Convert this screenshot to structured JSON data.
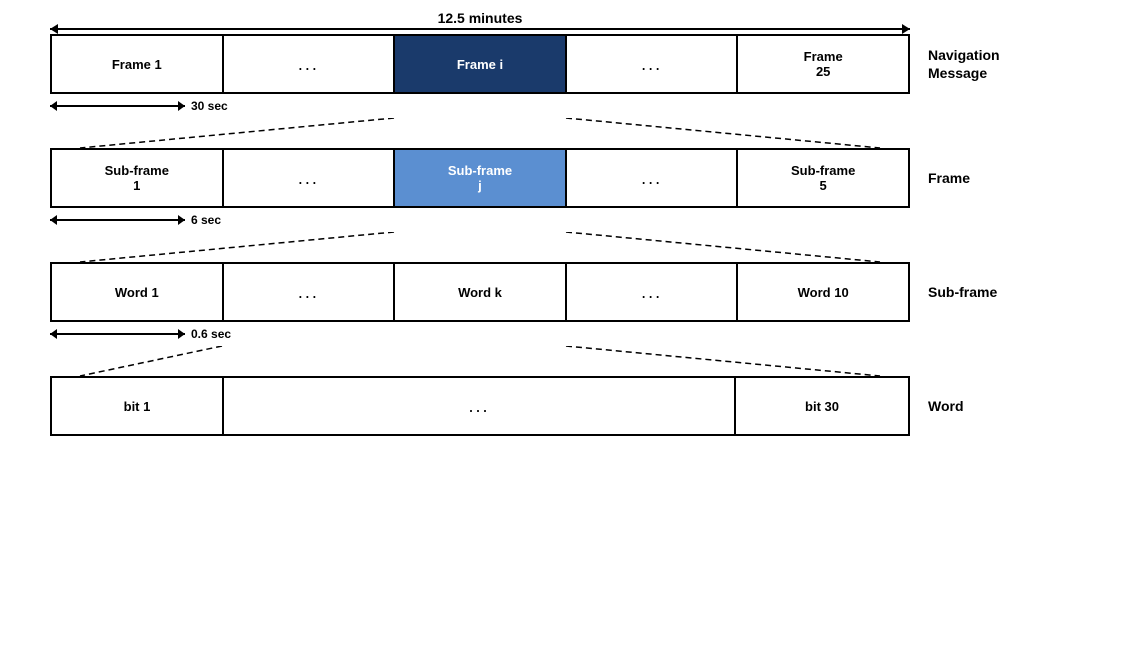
{
  "top_arrow": {
    "label": "12.5 minutes"
  },
  "rows": [
    {
      "id": "nav-message",
      "cells": [
        {
          "label": "Frame 1",
          "type": "normal"
        },
        {
          "label": "...",
          "type": "dots"
        },
        {
          "label": "Frame i",
          "type": "highlight-dark"
        },
        {
          "label": "...",
          "type": "dots"
        },
        {
          "label": "Frame\n25",
          "type": "normal"
        }
      ],
      "side_label": "Navigation\nMessage",
      "duration": "30 sec"
    },
    {
      "id": "frame",
      "cells": [
        {
          "label": "Sub-frame\n1",
          "type": "normal"
        },
        {
          "label": "...",
          "type": "dots"
        },
        {
          "label": "Sub-frame\nj",
          "type": "highlight-light"
        },
        {
          "label": "...",
          "type": "dots"
        },
        {
          "label": "Sub-frame\n5",
          "type": "normal"
        }
      ],
      "side_label": "Frame",
      "duration": "6 sec"
    },
    {
      "id": "subframe",
      "cells": [
        {
          "label": "Word 1",
          "type": "normal"
        },
        {
          "label": "...",
          "type": "dots"
        },
        {
          "label": "Word k",
          "type": "normal"
        },
        {
          "label": "...",
          "type": "dots"
        },
        {
          "label": "Word 10",
          "type": "normal"
        }
      ],
      "side_label": "Sub-frame",
      "duration": "0.6 sec"
    },
    {
      "id": "word",
      "cells": [
        {
          "label": "bit 1",
          "type": "normal"
        },
        {
          "label": "...",
          "type": "dots"
        },
        {
          "label": "bit 30",
          "type": "normal"
        }
      ],
      "side_label": "Word",
      "duration": null
    }
  ]
}
